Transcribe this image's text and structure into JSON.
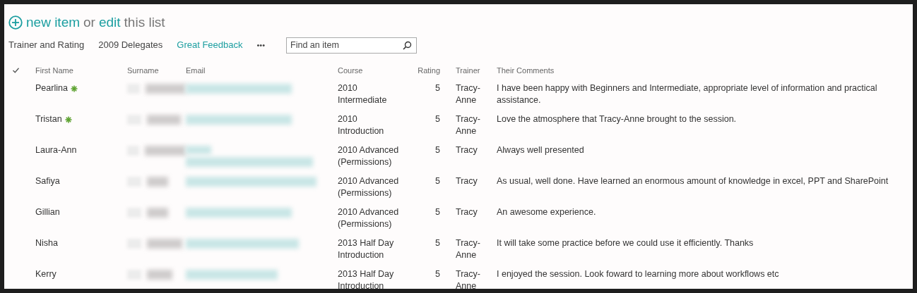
{
  "heading": {
    "new_item": "new item",
    "or": "or",
    "edit": "edit",
    "this_list": "this list"
  },
  "views": [
    {
      "label": "Trainer and Rating",
      "selected": false
    },
    {
      "label": "2009 Delegates",
      "selected": false
    },
    {
      "label": "Great Feedback",
      "selected": true
    }
  ],
  "more": "•••",
  "search": {
    "placeholder": "Find an item"
  },
  "columns": [
    "First Name",
    "Surname",
    "Email",
    "Course",
    "Rating",
    "Trainer",
    "Their Comments"
  ],
  "rows": [
    {
      "first_name": "Pearlina",
      "new": true,
      "course": "2010 Intermediate",
      "rating": "5",
      "trainer": "Tracy-Anne",
      "comments": "I have been happy with Beginners and Intermediate, appropriate level of information and practical assistance."
    },
    {
      "first_name": "Tristan",
      "new": true,
      "course": "2010 Introduction",
      "rating": "5",
      "trainer": "Tracy-Anne",
      "comments": "Love the atmosphere that Tracy-Anne brought to the session."
    },
    {
      "first_name": "Laura-Ann",
      "new": false,
      "course": "2010 Advanced (Permissions)",
      "rating": "5",
      "trainer": "Tracy",
      "comments": "Always well presented"
    },
    {
      "first_name": "Safiya",
      "new": false,
      "course": "2010 Advanced (Permissions)",
      "rating": "5",
      "trainer": "Tracy",
      "comments": "As usual, well done. Have learned an enormous amount of knowledge in excel, PPT and SharePoint"
    },
    {
      "first_name": "Gillian",
      "new": false,
      "course": "2010 Advanced (Permissions)",
      "rating": "5",
      "trainer": "Tracy",
      "comments": "An awesome experience."
    },
    {
      "first_name": "Nisha",
      "new": false,
      "course": "2013 Half Day Introduction",
      "rating": "5",
      "trainer": "Tracy-Anne",
      "comments": "It will take some practice before we could use it efficiently. Thanks"
    },
    {
      "first_name": "Kerry",
      "new": false,
      "course": "2013 Half Day Introduction",
      "rating": "5",
      "trainer": "Tracy-Anne",
      "comments": "I enjoyed the session. Look foward to learning more about workflows etc"
    }
  ]
}
